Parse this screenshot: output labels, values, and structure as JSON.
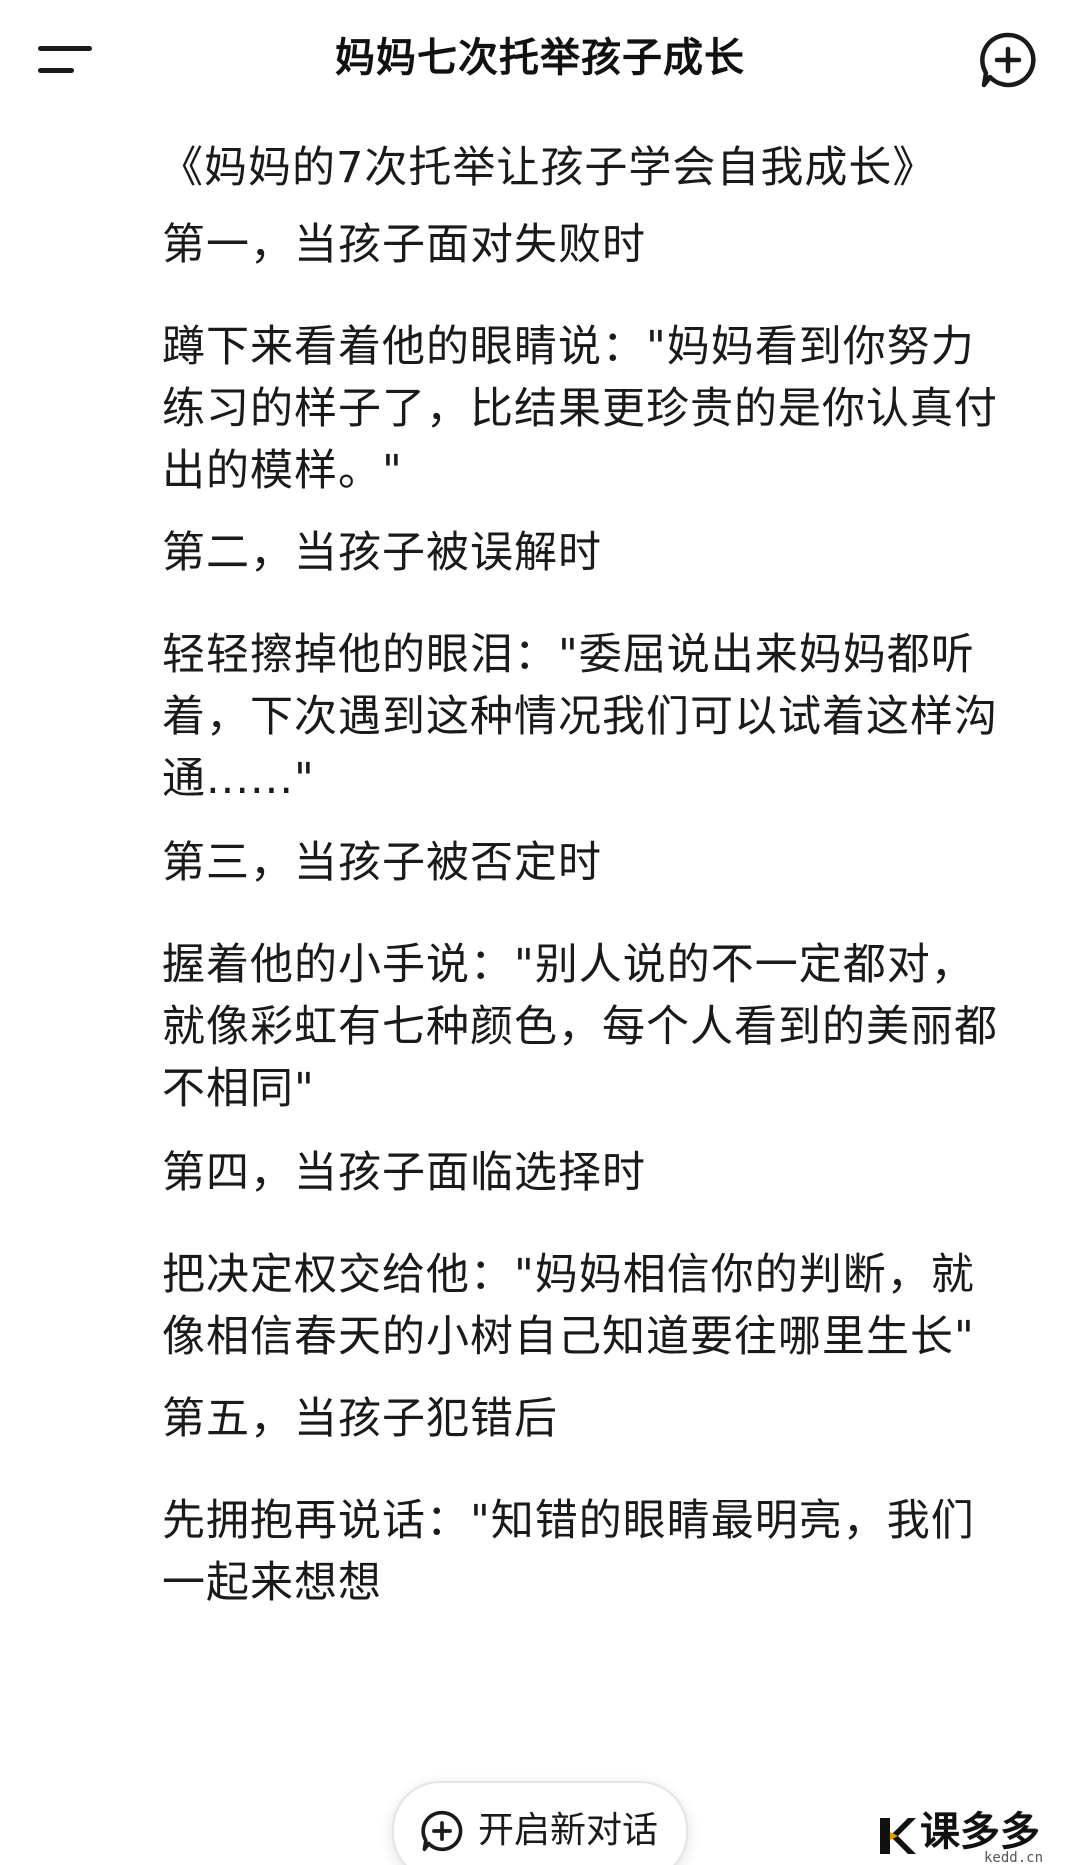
{
  "header": {
    "title": "妈妈七次托举孩子成长",
    "menu_icon": "hamburger-menu-icon",
    "new_chat_icon": "chat-plus-icon"
  },
  "article": {
    "doc_title": "《妈妈的7次托举让孩子学会自我成长》",
    "paragraphs": [
      "第一，当孩子面对失败时",
      "蹲下来看着他的眼睛说：\"妈妈看到你努力练习的样子了，比结果更珍贵的是你认真付出的模样。\"",
      "第二，当孩子被误解时",
      "轻轻擦掉他的眼泪：\"委屈说出来妈妈都听着，下次遇到这种情况我们可以试着这样沟通......\"",
      "第三，当孩子被否定时",
      "握着他的小手说：\"别人说的不一定都对，就像彩虹有七种颜色，每个人看到的美丽都不相同\"",
      "第四，当孩子面临选择时",
      "把决定权交给他：\"妈妈相信你的判断，就像相信春天的小树自己知道要往哪里生长\"",
      "第五，当孩子犯错后",
      "先拥抱再说话：\"知错的眼睛最明亮，我们一起来想想"
    ]
  },
  "bottom_bar": {
    "new_chat_label": "开启新对话",
    "new_chat_icon": "chat-plus-icon"
  },
  "watermark": {
    "text": "课多多",
    "url": "kedd.cn",
    "logo_icon": "k-logo-icon"
  },
  "colors": {
    "text": "#1a1a1a",
    "background": "#ffffff",
    "watermark_accent": "#f39800"
  }
}
